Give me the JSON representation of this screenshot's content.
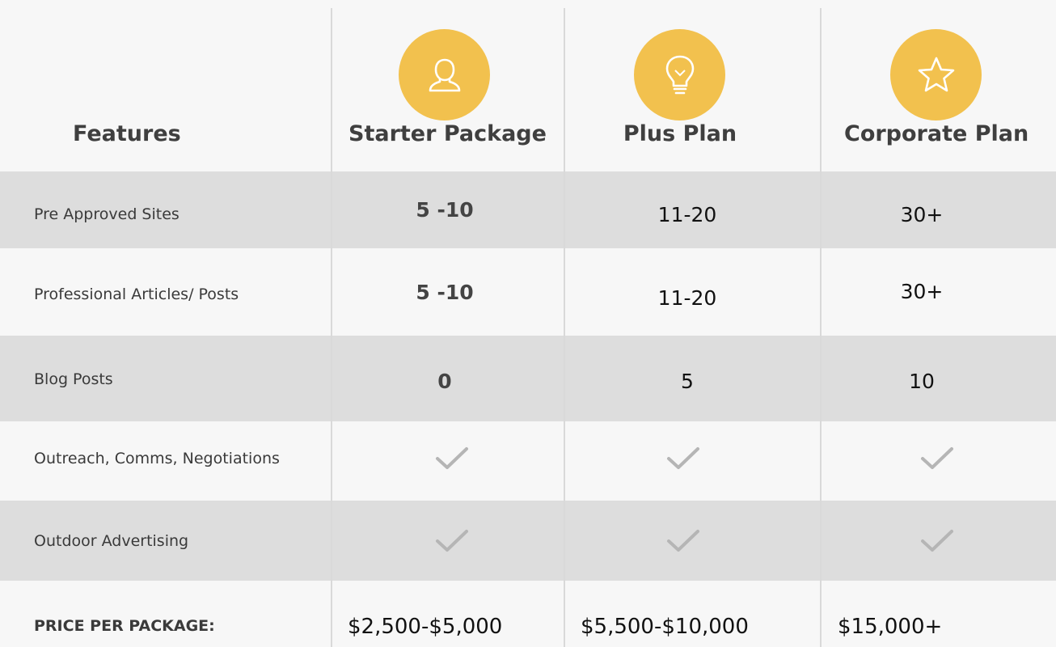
{
  "header": {
    "features_label": "Features",
    "plans": [
      {
        "name": "Starter Package",
        "icon": "user-icon"
      },
      {
        "name": "Plus Plan",
        "icon": "lightbulb-icon"
      },
      {
        "name": "Corporate Plan",
        "icon": "star-icon"
      }
    ]
  },
  "rows": [
    {
      "feature": "Pre Approved Sites",
      "values": [
        "5 -10",
        "11-20",
        "30+"
      ]
    },
    {
      "feature": "Professional Articles/ Posts",
      "values": [
        "5 -10",
        "11-20",
        "30+"
      ]
    },
    {
      "feature": "Blog Posts",
      "values": [
        "0",
        "5",
        "10"
      ]
    },
    {
      "feature": "Outreach, Comms, Negotiations",
      "values": [
        "check",
        "check",
        "check"
      ]
    },
    {
      "feature": "Outdoor Advertising",
      "values": [
        "check",
        "check",
        "check"
      ]
    }
  ],
  "pricing": {
    "label": "PRICE PER PACKAGE:",
    "prices": [
      "$2,500-$5,000",
      "$5,500-$10,000",
      "$15,000+"
    ]
  },
  "colors": {
    "accent": "#f2c14e",
    "row_shade": "#dddddd",
    "background": "#f7f7f7",
    "check": "#b5b5b5"
  }
}
